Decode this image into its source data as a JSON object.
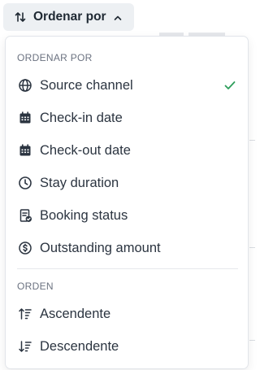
{
  "sort_button": {
    "label": "Ordenar por",
    "icon": "sort-arrows-icon",
    "chevron": "chevron-up-icon"
  },
  "menu": {
    "sort_by_title": "ORDENAR POR",
    "sort_by_items": [
      {
        "label": "Source channel",
        "icon": "globe-icon",
        "selected": true
      },
      {
        "label": "Check-in date",
        "icon": "calendar-icon",
        "selected": false
      },
      {
        "label": "Check-out date",
        "icon": "calendar-icon",
        "selected": false
      },
      {
        "label": "Stay duration",
        "icon": "clock-icon",
        "selected": false
      },
      {
        "label": "Booking status",
        "icon": "document-check-icon",
        "selected": false
      },
      {
        "label": "Outstanding amount",
        "icon": "dollar-circle-icon",
        "selected": false
      }
    ],
    "order_title": "ORDEN",
    "order_items": [
      {
        "label": "Ascendente",
        "icon": "sort-ascending-icon"
      },
      {
        "label": "Descendente",
        "icon": "sort-descending-icon"
      }
    ]
  },
  "colors": {
    "check": "#2e9e5b",
    "button_bg": "#edf0f3",
    "text": "#2b3440",
    "muted": "#6b7280"
  }
}
